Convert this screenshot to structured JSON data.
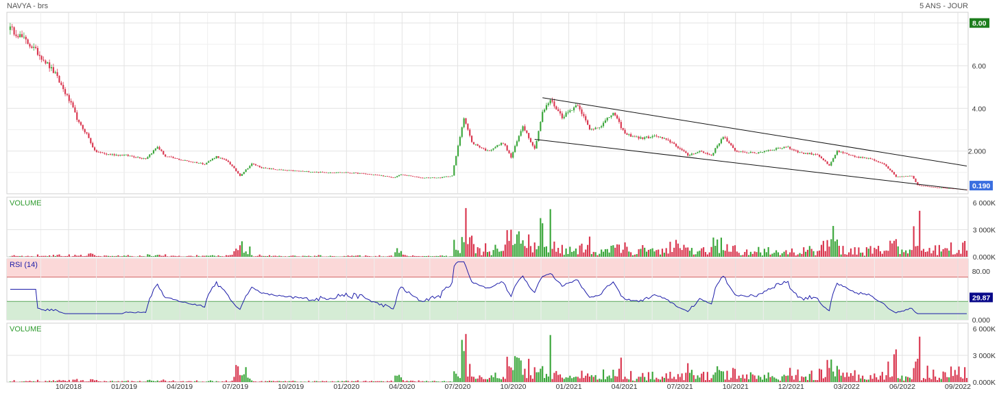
{
  "header": {
    "instrument": "NAVYA - brs",
    "period": "5 ANS - JOUR"
  },
  "colors": {
    "up": "#3aa63a",
    "down": "#d9354e",
    "rsi_line": "#1a1aa8",
    "last_price_bg": "#3b6fe0",
    "high_badge_bg": "#1c7d1c",
    "rsi_badge_bg": "#0a0a8a",
    "grid": "#e2e2e2",
    "overbought_fill": "#fbd8d8",
    "oversold_fill": "#d5ecd5",
    "volume_title": "#2d9a2d",
    "rsi_title": "#1a1aa8"
  },
  "chart_data": [
    {
      "type": "candlestick",
      "panel": "price",
      "ylim": [
        0,
        8.5
      ],
      "yticks": [
        "8.00",
        "6.00",
        "4.00",
        "2.000"
      ],
      "ytick_values": [
        8,
        6,
        4,
        2
      ],
      "last_price_label": "0.190",
      "last_price": 0.19,
      "high_label": "8.00",
      "high_value": 8.0,
      "x_labels": [
        "10/2018",
        "01/2019",
        "04/2019",
        "07/2019",
        "10/2019",
        "01/2020",
        "04/2020",
        "07/2020",
        "10/2020",
        "01/2021",
        "04/2021",
        "07/2021",
        "10/2021",
        "12/2021",
        "03/2022",
        "06/2022",
        "09/2022"
      ],
      "close_anchors": [
        [
          0,
          7.8
        ],
        [
          6,
          7.4
        ],
        [
          12,
          6.9
        ],
        [
          18,
          6.3
        ],
        [
          24,
          5.6
        ],
        [
          28,
          4.9
        ],
        [
          32,
          4.2
        ],
        [
          36,
          3.3
        ],
        [
          40,
          2.8
        ],
        [
          44,
          2.0
        ],
        [
          50,
          1.85
        ],
        [
          60,
          1.8
        ],
        [
          70,
          1.65
        ],
        [
          76,
          2.2
        ],
        [
          80,
          1.75
        ],
        [
          90,
          1.55
        ],
        [
          100,
          1.4
        ],
        [
          106,
          1.75
        ],
        [
          112,
          1.5
        ],
        [
          118,
          0.85
        ],
        [
          124,
          1.4
        ],
        [
          130,
          1.2
        ],
        [
          140,
          1.1
        ],
        [
          150,
          1.05
        ],
        [
          160,
          1.0
        ],
        [
          170,
          1.0
        ],
        [
          180,
          0.95
        ],
        [
          190,
          0.85
        ],
        [
          196,
          0.75
        ],
        [
          200,
          0.9
        ],
        [
          210,
          0.75
        ],
        [
          220,
          0.75
        ],
        [
          226,
          0.85
        ],
        [
          232,
          3.6
        ],
        [
          236,
          2.4
        ],
        [
          244,
          2.0
        ],
        [
          252,
          2.4
        ],
        [
          256,
          1.7
        ],
        [
          262,
          3.2
        ],
        [
          268,
          2.1
        ],
        [
          272,
          3.8
        ],
        [
          276,
          4.4
        ],
        [
          282,
          3.6
        ],
        [
          290,
          4.2
        ],
        [
          296,
          3.0
        ],
        [
          302,
          3.2
        ],
        [
          308,
          3.8
        ],
        [
          314,
          2.8
        ],
        [
          322,
          2.6
        ],
        [
          330,
          2.7
        ],
        [
          338,
          2.4
        ],
        [
          346,
          1.8
        ],
        [
          352,
          2.0
        ],
        [
          358,
          1.8
        ],
        [
          364,
          2.7
        ],
        [
          370,
          2.0
        ],
        [
          380,
          1.9
        ],
        [
          390,
          2.1
        ],
        [
          396,
          2.2
        ],
        [
          404,
          1.9
        ],
        [
          412,
          1.85
        ],
        [
          418,
          1.3
        ],
        [
          422,
          2.0
        ],
        [
          430,
          1.75
        ],
        [
          438,
          1.65
        ],
        [
          446,
          1.4
        ],
        [
          452,
          0.8
        ],
        [
          460,
          0.85
        ],
        [
          463,
          0.4
        ],
        [
          472,
          0.3
        ],
        [
          480,
          0.25
        ],
        [
          488,
          0.19
        ]
      ],
      "total_days": 488,
      "trend_lines": [
        {
          "from": [
            272,
            4.5
          ],
          "to": [
            488,
            1.3
          ]
        },
        {
          "from": [
            268,
            2.55
          ],
          "to": [
            488,
            0.18
          ]
        }
      ]
    },
    {
      "type": "bar",
      "panel": "volume",
      "title": "VOLUME",
      "ylim": [
        0,
        6000000
      ],
      "yticks": [
        "6 000K",
        "3 000K",
        "0.000K"
      ]
    },
    {
      "type": "line",
      "panel": "rsi",
      "title": "RSI (14)",
      "ylim": [
        0,
        100
      ],
      "overbought": 70,
      "oversold": 30,
      "yticks": [
        "80.00",
        "0.000"
      ],
      "ytick_values": [
        80,
        0
      ],
      "last_value_label": "29.87",
      "last_value": 29.87
    },
    {
      "type": "bar",
      "panel": "volume2",
      "title": "VOLUME",
      "ylim": [
        0,
        6000000
      ],
      "yticks": [
        "6 000K",
        "3 000K",
        "0.000K"
      ]
    }
  ]
}
